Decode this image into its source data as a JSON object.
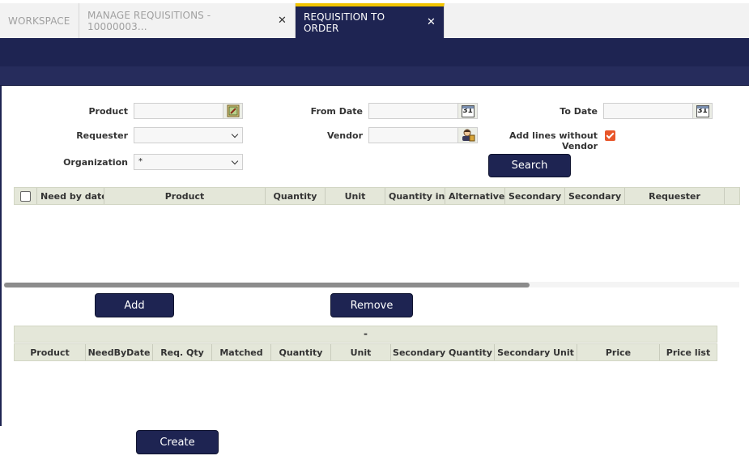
{
  "tabs": [
    {
      "label": "WORKSPACE",
      "active": false,
      "closable": false
    },
    {
      "label": "MANAGE REQUISITIONS - 10000003...",
      "active": false,
      "closable": true
    },
    {
      "label": "REQUISITION TO ORDER",
      "active": true,
      "closable": true
    }
  ],
  "close_glyph": "✕",
  "form": {
    "product_label": "Product",
    "requester_label": "Requester",
    "organization_label": "Organization",
    "organization_value": "*",
    "from_date_label": "From Date",
    "vendor_label": "Vendor",
    "to_date_label": "To Date",
    "add_lines_label_1": "Add lines without",
    "add_lines_label_2": "Vendor",
    "add_lines_checked": true,
    "calendar_glyph": "31"
  },
  "buttons": {
    "search": "Search",
    "add": "Add",
    "remove": "Remove",
    "create": "Create"
  },
  "upper_grid": {
    "columns": [
      "Need by date",
      "Product",
      "Quantity",
      "Unit",
      "Quantity in",
      "Alternative",
      "Secondary",
      "Secondary",
      "Requester"
    ]
  },
  "lower_grid": {
    "group_header": "-",
    "columns": [
      "Product",
      "NeedByDate",
      "Req. Qty",
      "Matched",
      "Quantity",
      "Unit",
      "Secondary Quantity",
      "Secondary Unit",
      "Price",
      "Price list"
    ]
  },
  "colors": {
    "navy": "#1e2452",
    "active_tab_accent": "#f2c400",
    "checkbox": "#e8562a",
    "grid_header": "#e4e7d9"
  },
  "icons": {
    "product_selector": "product-selector-icon",
    "calendar": "calendar-icon",
    "vendor_selector": "business-partner-icon"
  }
}
